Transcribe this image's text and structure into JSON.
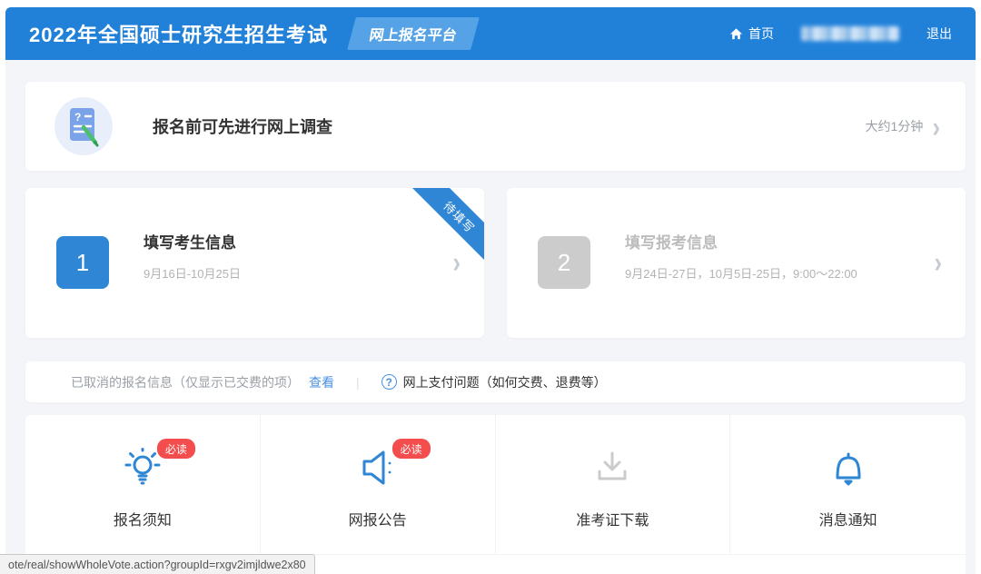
{
  "header": {
    "title": "2022年全国硕士研究生招生考试",
    "badge": "网上报名平台",
    "home": "首页",
    "logout": "退出"
  },
  "survey": {
    "title": "报名前可先进行网上调查",
    "duration": "大约1分钟",
    "chevron": "›"
  },
  "steps": [
    {
      "number": "1",
      "title": "填写考生信息",
      "dates": "9月16日-10月25日",
      "ribbon": "待填写",
      "chevron": "›"
    },
    {
      "number": "2",
      "title": "填写报考信息",
      "dates": "9月24日-27日，10月5日-25日，9:00～22:00",
      "chevron": "›"
    }
  ],
  "cancel_bar": {
    "info": "已取消的报名信息（仅显示已交费的项）",
    "view_link": "查看",
    "divider": "|",
    "help_mark": "?",
    "payment": "网上支付问题（如何交费、退费等）"
  },
  "shortcuts": [
    {
      "label": "报名须知",
      "badge": "必读",
      "icon": "bulb-icon"
    },
    {
      "label": "网报公告",
      "badge": "必读",
      "icon": "megaphone-icon"
    },
    {
      "label": "准考证下载",
      "icon": "download-icon"
    },
    {
      "label": "消息通知",
      "icon": "bell-icon"
    }
  ],
  "status_bar": {
    "url": "ote/real/showWholeVote.action?groupId=rxgv2imjldwe2x80"
  },
  "colors": {
    "header_blue": "#2181d9",
    "badge_blue": "#55a3e6",
    "accent_blue": "#2e86d5",
    "link_blue": "#4a90e2",
    "badge_red": "#f34d4d",
    "inactive_gray": "#cccccc",
    "page_bg": "#f4f5f8"
  }
}
